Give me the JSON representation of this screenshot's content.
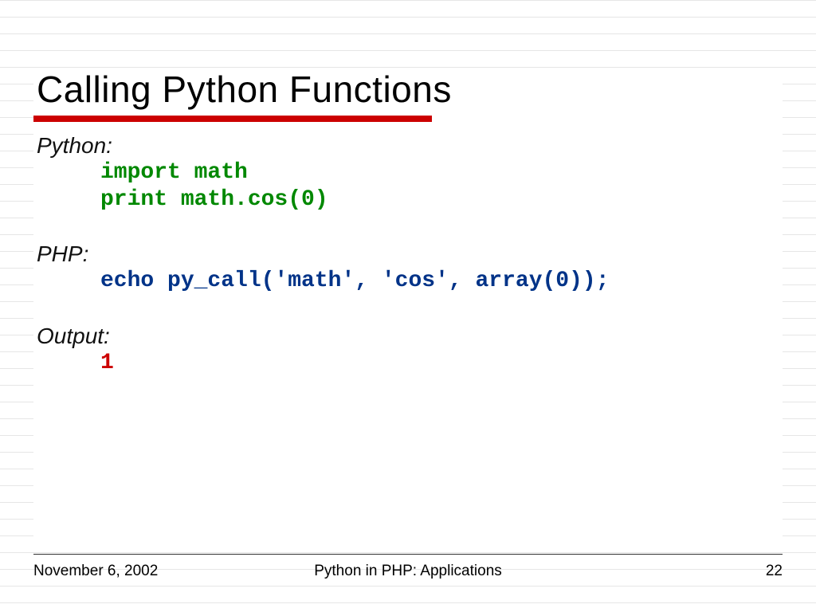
{
  "slide": {
    "title": "Calling Python Functions",
    "python_label": "Python:",
    "python_line1": "import math",
    "python_line2": "print math.cos(0)",
    "php_label": "PHP:",
    "php_line1": "echo py_call('math', 'cos', array(0));",
    "output_label": "Output:",
    "output_line1": "1"
  },
  "footer": {
    "date": "November 6, 2002",
    "title": "Python in PHP: Applications",
    "page": "22"
  }
}
